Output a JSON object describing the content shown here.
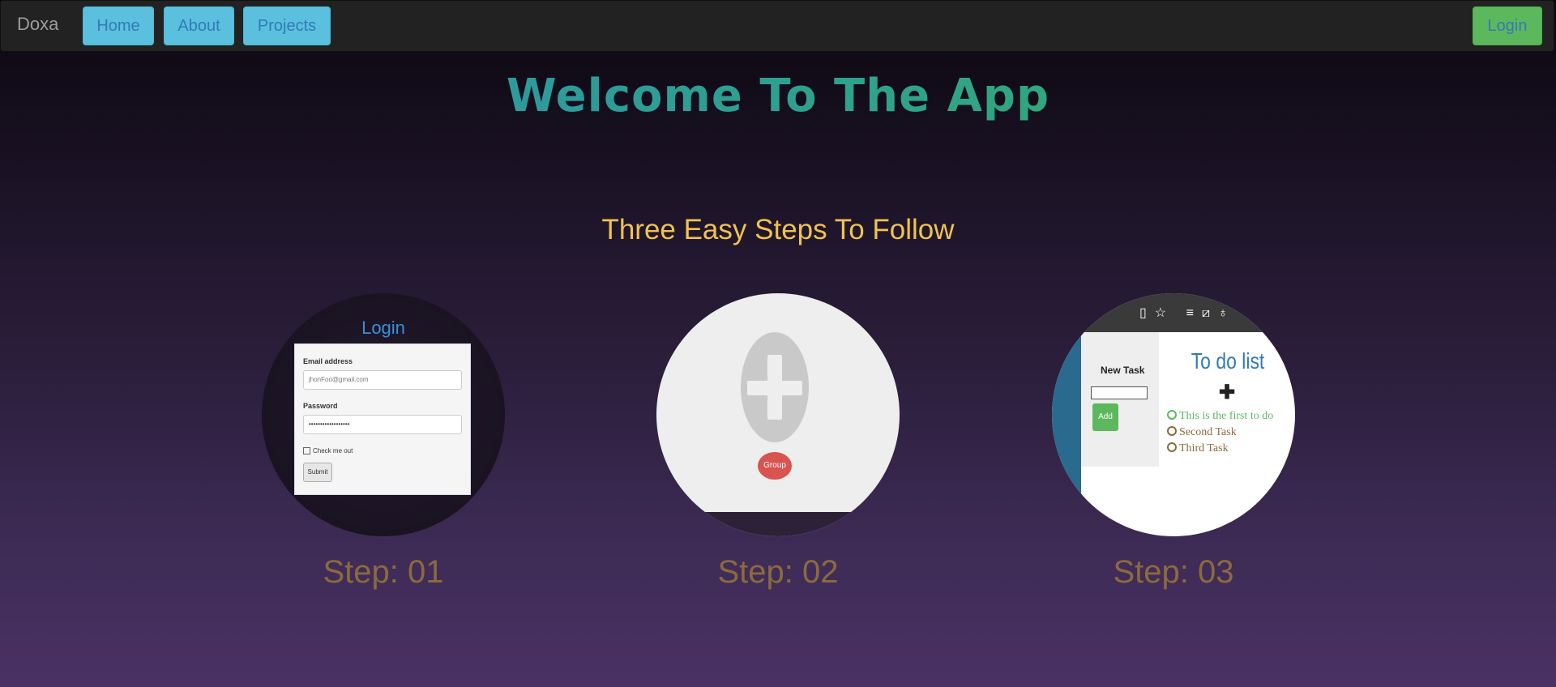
{
  "navbar": {
    "brand": "Doxa",
    "links": [
      "Home",
      "About",
      "Projects"
    ],
    "login_label": "Login"
  },
  "hero": {
    "title": "Welcome To The App",
    "subtitle": "Three Easy Steps To Follow"
  },
  "steps": [
    {
      "label": "Step: 01",
      "preview": {
        "title": "Login",
        "email_label": "Email address",
        "email_value": "jhonFoo@gmail.com",
        "password_label": "Password",
        "password_value": "••••••••••••••••••",
        "checkbox_label": "Check me out",
        "submit_label": "Submit"
      }
    },
    {
      "label": "Step: 02",
      "preview": {
        "icon": "plus-icon",
        "group_label": "Group"
      }
    },
    {
      "label": "Step: 03",
      "preview": {
        "new_task_label": "New Task",
        "add_label": "Add",
        "title": "To do list",
        "tasks": [
          {
            "text": "This is the first to do",
            "color": "#5cb85c"
          },
          {
            "text": "Second Task",
            "color": "#8c6a3d"
          },
          {
            "text": "Third Task",
            "color": "#8c6a3d"
          }
        ]
      }
    }
  ],
  "colors": {
    "title_gradient": [
      "#2a8fb6",
      "#3bb24e"
    ],
    "subtitle": "#f0c24f",
    "step_label": "#8c6a3d",
    "nav_button": "#5bc0de",
    "login_button": "#5cb85c"
  }
}
